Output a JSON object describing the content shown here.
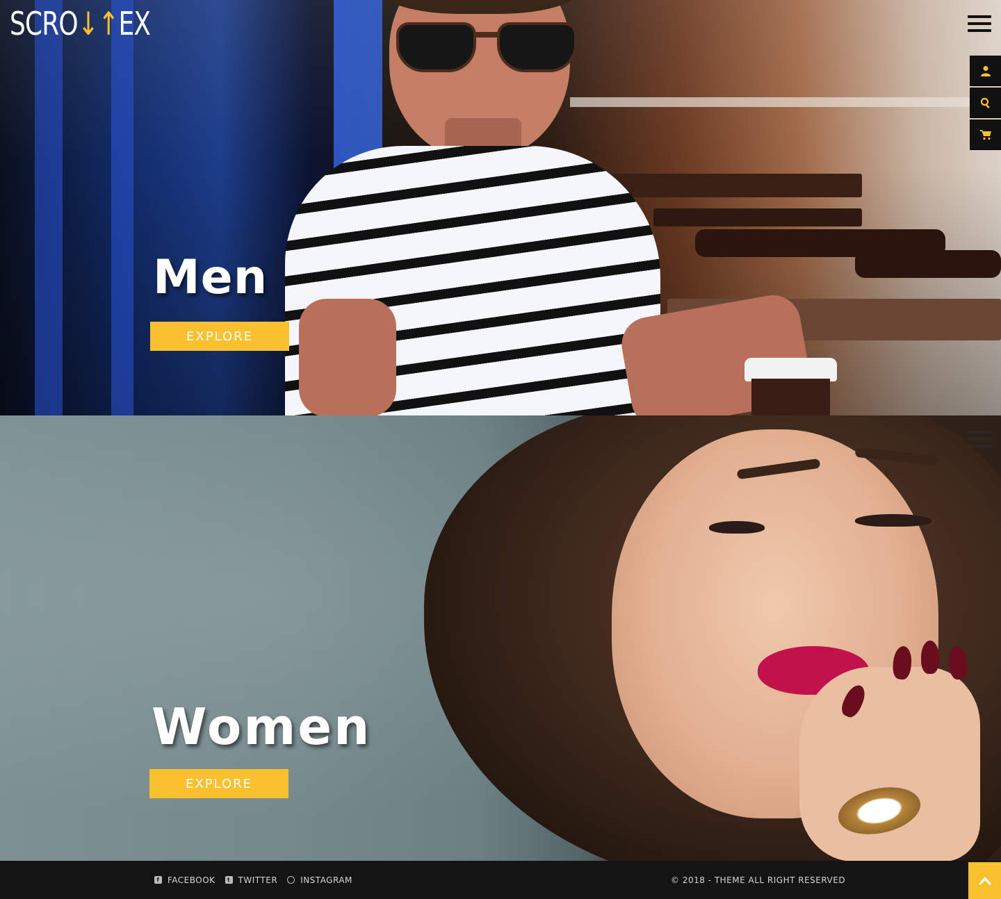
{
  "brand": {
    "logo_left": "SCRO",
    "logo_arrows": "↓↑",
    "logo_right": "EX",
    "accent_color": "#fbc02d"
  },
  "header": {
    "menu_icon": "hamburger-menu-icon",
    "tools": [
      {
        "icon": "user-icon"
      },
      {
        "icon": "search-icon"
      },
      {
        "icon": "cart-icon"
      }
    ]
  },
  "sections": {
    "men": {
      "title": "Men",
      "button_label": "EXPLORE"
    },
    "women": {
      "title": "Women",
      "button_label": "EXPLORE"
    }
  },
  "footer": {
    "social": [
      {
        "label": "FACEBOOK",
        "icon": "facebook-icon"
      },
      {
        "label": "TWITTER",
        "icon": "twitter-icon"
      },
      {
        "label": "INSTAGRAM",
        "icon": "instagram-icon"
      }
    ],
    "copyright": "© 2018 - THEME ALL RIGHT RESERVED",
    "back_to_top_icon": "arrow-up-icon"
  }
}
